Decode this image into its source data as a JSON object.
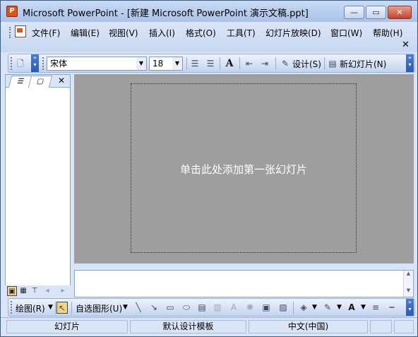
{
  "window": {
    "title": "Microsoft PowerPoint - [新建 Microsoft PowerPoint 演示文稿.ppt]",
    "min_glyph": "—",
    "max_glyph": "▭",
    "close_glyph": "✕"
  },
  "menu": {
    "items": [
      "文件(F)",
      "编辑(E)",
      "视图(V)",
      "插入(I)",
      "格式(O)",
      "工具(T)",
      "幻灯片放映(D)",
      "窗口(W)",
      "帮助(H)"
    ],
    "doc_close": "✕"
  },
  "format_toolbar": {
    "font_name": "宋体",
    "font_size": "18",
    "design_label": "设计(S)",
    "new_slide_label": "新幻灯片(N)"
  },
  "slide": {
    "placeholder": "单击此处添加第一张幻灯片"
  },
  "drawing_toolbar": {
    "draw_label": "绘图(R)",
    "autoshapes_label": "自选图形(U)"
  },
  "status": {
    "slide": "幻灯片",
    "template": "默认设计模板",
    "language": "中文(中国)"
  },
  "colors": {
    "accent": "#2a5bb5",
    "workspace": "#9e9e9e",
    "app_icon": "#d9541e"
  }
}
